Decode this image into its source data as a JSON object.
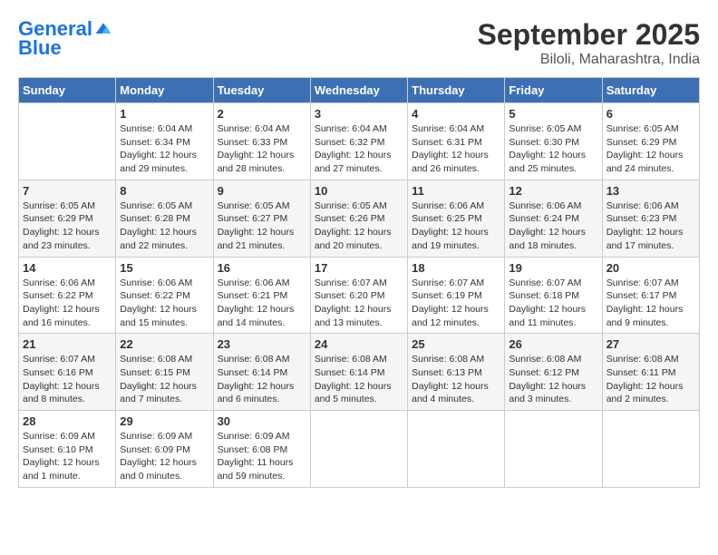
{
  "logo": {
    "line1": "General",
    "line2": "Blue"
  },
  "title": "September 2025",
  "subtitle": "Biloli, Maharashtra, India",
  "weekdays": [
    "Sunday",
    "Monday",
    "Tuesday",
    "Wednesday",
    "Thursday",
    "Friday",
    "Saturday"
  ],
  "weeks": [
    [
      {
        "day": "",
        "info": ""
      },
      {
        "day": "1",
        "info": "Sunrise: 6:04 AM\nSunset: 6:34 PM\nDaylight: 12 hours\nand 29 minutes."
      },
      {
        "day": "2",
        "info": "Sunrise: 6:04 AM\nSunset: 6:33 PM\nDaylight: 12 hours\nand 28 minutes."
      },
      {
        "day": "3",
        "info": "Sunrise: 6:04 AM\nSunset: 6:32 PM\nDaylight: 12 hours\nand 27 minutes."
      },
      {
        "day": "4",
        "info": "Sunrise: 6:04 AM\nSunset: 6:31 PM\nDaylight: 12 hours\nand 26 minutes."
      },
      {
        "day": "5",
        "info": "Sunrise: 6:05 AM\nSunset: 6:30 PM\nDaylight: 12 hours\nand 25 minutes."
      },
      {
        "day": "6",
        "info": "Sunrise: 6:05 AM\nSunset: 6:29 PM\nDaylight: 12 hours\nand 24 minutes."
      }
    ],
    [
      {
        "day": "7",
        "info": "Sunrise: 6:05 AM\nSunset: 6:29 PM\nDaylight: 12 hours\nand 23 minutes."
      },
      {
        "day": "8",
        "info": "Sunrise: 6:05 AM\nSunset: 6:28 PM\nDaylight: 12 hours\nand 22 minutes."
      },
      {
        "day": "9",
        "info": "Sunrise: 6:05 AM\nSunset: 6:27 PM\nDaylight: 12 hours\nand 21 minutes."
      },
      {
        "day": "10",
        "info": "Sunrise: 6:05 AM\nSunset: 6:26 PM\nDaylight: 12 hours\nand 20 minutes."
      },
      {
        "day": "11",
        "info": "Sunrise: 6:06 AM\nSunset: 6:25 PM\nDaylight: 12 hours\nand 19 minutes."
      },
      {
        "day": "12",
        "info": "Sunrise: 6:06 AM\nSunset: 6:24 PM\nDaylight: 12 hours\nand 18 minutes."
      },
      {
        "day": "13",
        "info": "Sunrise: 6:06 AM\nSunset: 6:23 PM\nDaylight: 12 hours\nand 17 minutes."
      }
    ],
    [
      {
        "day": "14",
        "info": "Sunrise: 6:06 AM\nSunset: 6:22 PM\nDaylight: 12 hours\nand 16 minutes."
      },
      {
        "day": "15",
        "info": "Sunrise: 6:06 AM\nSunset: 6:22 PM\nDaylight: 12 hours\nand 15 minutes."
      },
      {
        "day": "16",
        "info": "Sunrise: 6:06 AM\nSunset: 6:21 PM\nDaylight: 12 hours\nand 14 minutes."
      },
      {
        "day": "17",
        "info": "Sunrise: 6:07 AM\nSunset: 6:20 PM\nDaylight: 12 hours\nand 13 minutes."
      },
      {
        "day": "18",
        "info": "Sunrise: 6:07 AM\nSunset: 6:19 PM\nDaylight: 12 hours\nand 12 minutes."
      },
      {
        "day": "19",
        "info": "Sunrise: 6:07 AM\nSunset: 6:18 PM\nDaylight: 12 hours\nand 11 minutes."
      },
      {
        "day": "20",
        "info": "Sunrise: 6:07 AM\nSunset: 6:17 PM\nDaylight: 12 hours\nand 9 minutes."
      }
    ],
    [
      {
        "day": "21",
        "info": "Sunrise: 6:07 AM\nSunset: 6:16 PM\nDaylight: 12 hours\nand 8 minutes."
      },
      {
        "day": "22",
        "info": "Sunrise: 6:08 AM\nSunset: 6:15 PM\nDaylight: 12 hours\nand 7 minutes."
      },
      {
        "day": "23",
        "info": "Sunrise: 6:08 AM\nSunset: 6:14 PM\nDaylight: 12 hours\nand 6 minutes."
      },
      {
        "day": "24",
        "info": "Sunrise: 6:08 AM\nSunset: 6:14 PM\nDaylight: 12 hours\nand 5 minutes."
      },
      {
        "day": "25",
        "info": "Sunrise: 6:08 AM\nSunset: 6:13 PM\nDaylight: 12 hours\nand 4 minutes."
      },
      {
        "day": "26",
        "info": "Sunrise: 6:08 AM\nSunset: 6:12 PM\nDaylight: 12 hours\nand 3 minutes."
      },
      {
        "day": "27",
        "info": "Sunrise: 6:08 AM\nSunset: 6:11 PM\nDaylight: 12 hours\nand 2 minutes."
      }
    ],
    [
      {
        "day": "28",
        "info": "Sunrise: 6:09 AM\nSunset: 6:10 PM\nDaylight: 12 hours\nand 1 minute."
      },
      {
        "day": "29",
        "info": "Sunrise: 6:09 AM\nSunset: 6:09 PM\nDaylight: 12 hours\nand 0 minutes."
      },
      {
        "day": "30",
        "info": "Sunrise: 6:09 AM\nSunset: 6:08 PM\nDaylight: 11 hours\nand 59 minutes."
      },
      {
        "day": "",
        "info": ""
      },
      {
        "day": "",
        "info": ""
      },
      {
        "day": "",
        "info": ""
      },
      {
        "day": "",
        "info": ""
      }
    ]
  ]
}
